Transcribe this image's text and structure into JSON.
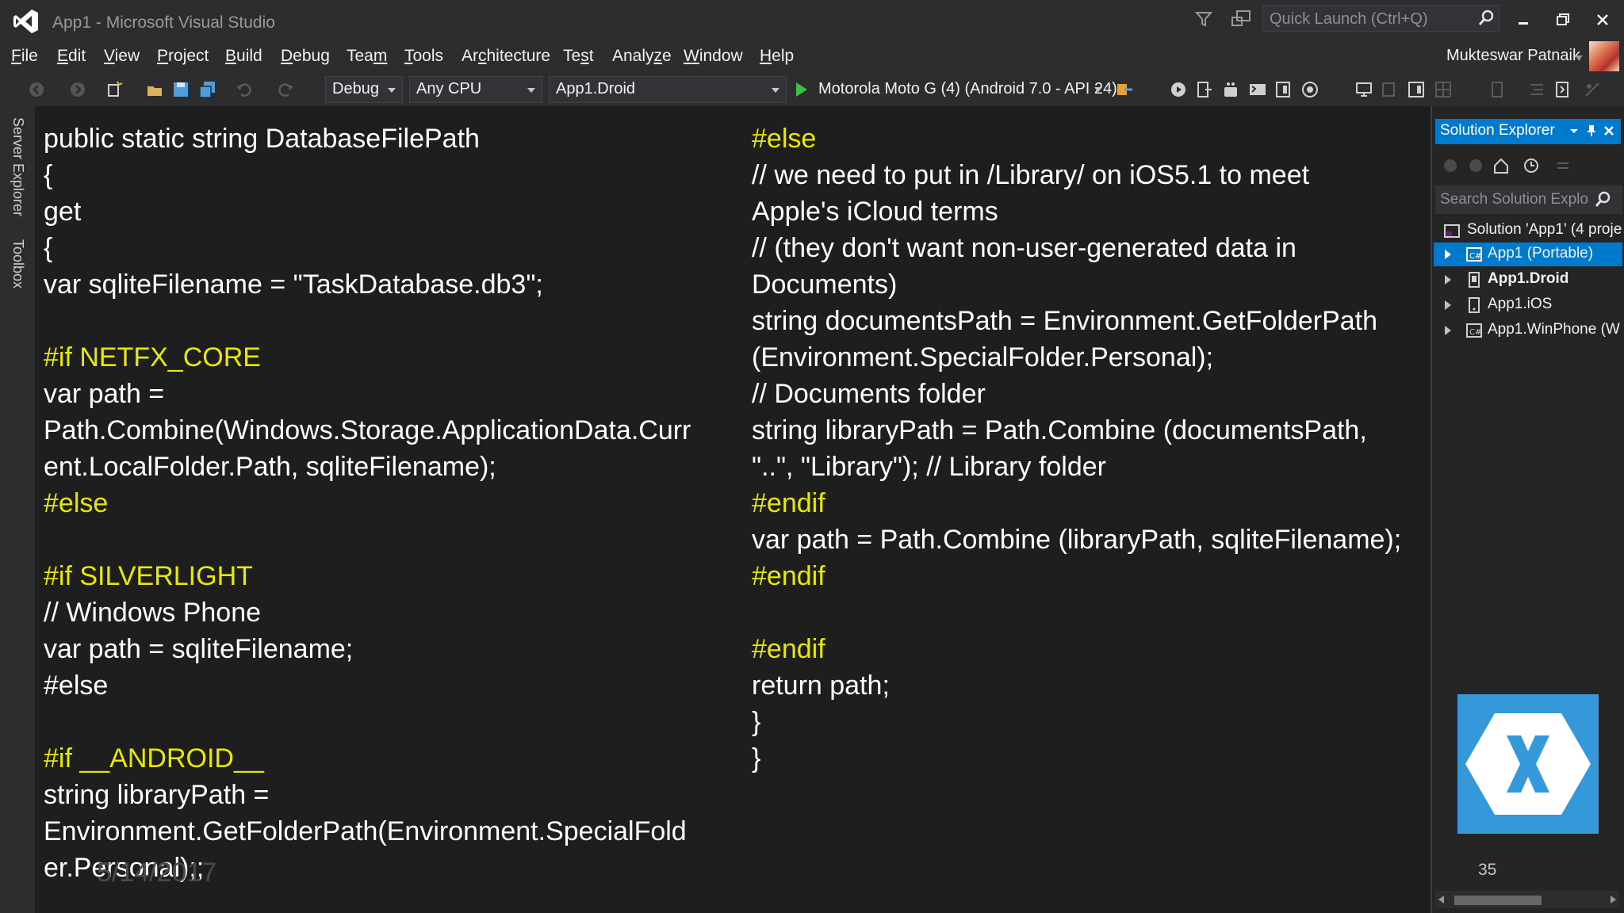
{
  "window": {
    "title": "App1 - Microsoft Visual Studio",
    "quick_launch_placeholder": "Quick Launch (Ctrl+Q)"
  },
  "menu": {
    "items": [
      {
        "label": "File",
        "mnemonic": "F",
        "rest": "ile"
      },
      {
        "label": "Edit",
        "mnemonic": "E",
        "rest": "dit"
      },
      {
        "label": "View",
        "mnemonic": "V",
        "rest": "iew"
      },
      {
        "label": "Project",
        "mnemonic": "P",
        "rest": "roject"
      },
      {
        "label": "Build",
        "mnemonic": "B",
        "rest": "uild"
      },
      {
        "label": "Debug",
        "mnemonic": "D",
        "rest": "ebug"
      },
      {
        "label": "Team",
        "pre": "Tea",
        "mnemonic": "m",
        "rest": ""
      },
      {
        "label": "Tools",
        "mnemonic": "T",
        "rest": "ools"
      },
      {
        "label": "Architecture",
        "pre": "Ar",
        "mnemonic": "c",
        "rest": "hitecture"
      },
      {
        "label": "Test",
        "pre": "Te",
        "mnemonic": "s",
        "rest": "t"
      },
      {
        "label": "Analyze",
        "pre": "Analy",
        "mnemonic": "z",
        "rest": "e"
      },
      {
        "label": "Window",
        "mnemonic": "W",
        "rest": "indow"
      },
      {
        "label": "Help",
        "mnemonic": "H",
        "rest": "elp"
      }
    ],
    "user_name": "Mukteswar Patnaik"
  },
  "toolbar": {
    "configuration": "Debug",
    "platform": "Any CPU",
    "startup_project": "App1.Droid",
    "run_target": "Motorola Moto G (4) (Android 7.0 - API 24)"
  },
  "side_tabs": [
    "Server Explorer",
    "Toolbox"
  ],
  "code": {
    "left": [
      {
        "text": "public static string DatabaseFilePath",
        "kind": "code"
      },
      {
        "text": "{",
        "kind": "code"
      },
      {
        "text": "get",
        "kind": "code"
      },
      {
        "text": "{",
        "kind": "code"
      },
      {
        "text": "var sqliteFilename = \"TaskDatabase.db3\";",
        "kind": "code"
      },
      {
        "text": "",
        "kind": "blank"
      },
      {
        "text": "#if NETFX_CORE",
        "kind": "dir"
      },
      {
        "text": "var path =",
        "kind": "code"
      },
      {
        "text": "Path.Combine(Windows.Storage.ApplicationData.Curr",
        "kind": "code"
      },
      {
        "text": "ent.LocalFolder.Path, sqliteFilename);",
        "kind": "code"
      },
      {
        "text": "#else",
        "kind": "dir"
      },
      {
        "text": "",
        "kind": "blank"
      },
      {
        "text": "#if SILVERLIGHT",
        "kind": "dir"
      },
      {
        "text": "// Windows Phone",
        "kind": "code"
      },
      {
        "text": "var path = sqliteFilename;",
        "kind": "code"
      },
      {
        "text": "#else",
        "kind": "code"
      },
      {
        "text": "",
        "kind": "blank"
      },
      {
        "text": "#if __ANDROID__",
        "kind": "dir"
      },
      {
        "text": "string libraryPath =",
        "kind": "code"
      },
      {
        "text": "Environment.GetFolderPath(Environment.SpecialFold",
        "kind": "code"
      },
      {
        "text": "er.Personal);;",
        "kind": "code"
      }
    ],
    "right": [
      {
        "text": "#else",
        "kind": "dir"
      },
      {
        "text": "// we need to put in /Library/ on iOS5.1 to meet",
        "kind": "code"
      },
      {
        "text": "Apple's iCloud terms",
        "kind": "code"
      },
      {
        "text": "// (they don't want non-user-generated data in",
        "kind": "code"
      },
      {
        "text": "Documents)",
        "kind": "code"
      },
      {
        "text": "string documentsPath = Environment.GetFolderPath",
        "kind": "code"
      },
      {
        "text": "(Environment.SpecialFolder.Personal);",
        "kind": "code"
      },
      {
        "text": "// Documents folder",
        "kind": "code"
      },
      {
        "text": "string libraryPath = Path.Combine (documentsPath,",
        "kind": "code"
      },
      {
        "text": "\"..\", \"Library\"); // Library folder",
        "kind": "code"
      },
      {
        "text": "#endif",
        "kind": "dir"
      },
      {
        "text": "var path = Path.Combine (libraryPath, sqliteFilename);",
        "kind": "code"
      },
      {
        "text": "#endif",
        "kind": "dir"
      },
      {
        "text": "",
        "kind": "blank"
      },
      {
        "text": "#endif",
        "kind": "dir"
      },
      {
        "text": "return path;",
        "kind": "code"
      },
      {
        "text": "}",
        "kind": "code"
      },
      {
        "text": "}",
        "kind": "code"
      }
    ],
    "watermark": "5/14/2017"
  },
  "solution_explorer": {
    "title": "Solution Explorer",
    "search_placeholder": "Search Solution Explo",
    "items": [
      {
        "label": "Solution 'App1' (4 proje",
        "type": "solution",
        "selected": false,
        "bold": false
      },
      {
        "label": "App1 (Portable)",
        "type": "csharp",
        "selected": true,
        "bold": false
      },
      {
        "label": "App1.Droid",
        "type": "android",
        "selected": false,
        "bold": true
      },
      {
        "label": "App1.iOS",
        "type": "ios",
        "selected": false,
        "bold": false
      },
      {
        "label": "App1.WinPhone (W",
        "type": "csharp",
        "selected": false,
        "bold": false
      }
    ]
  },
  "slide_number": "35",
  "colors": {
    "accent": "#007acc",
    "directive": "#e8e800",
    "xamarin": "#3498db",
    "play": "#3fbf3f"
  }
}
